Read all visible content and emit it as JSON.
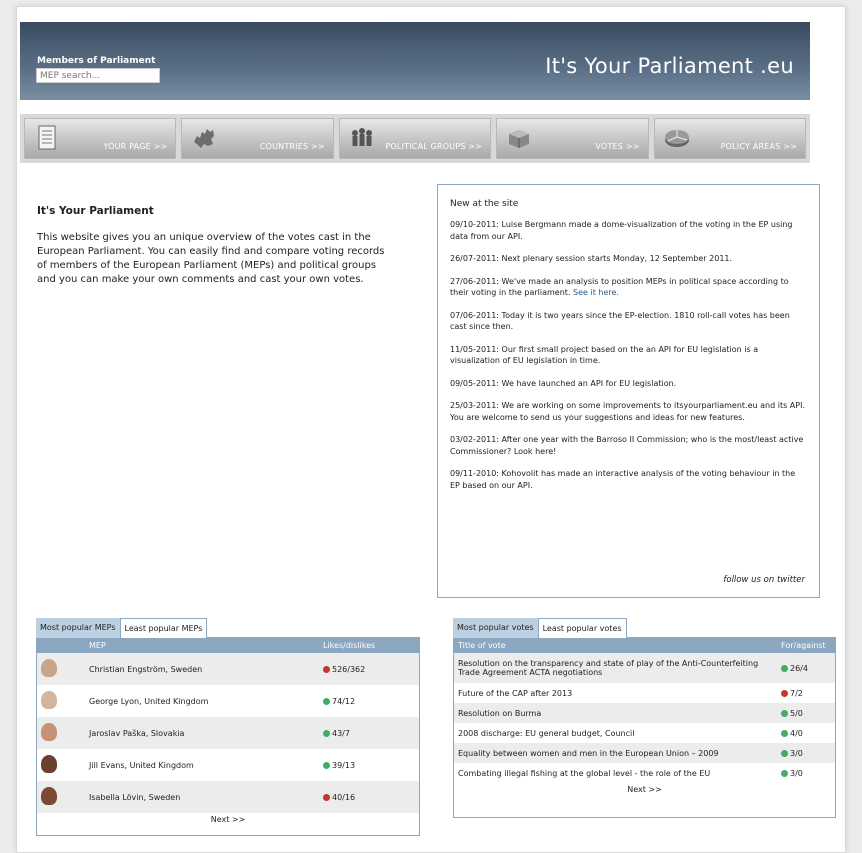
{
  "header": {
    "mep_label": "Members of Parliament",
    "search_placeholder": "MEP search...",
    "site_title": "It's Your Parliament .eu"
  },
  "nav": [
    {
      "label": "YOUR PAGE >>",
      "icon": "document-icon"
    },
    {
      "label": "COUNTRIES >>",
      "icon": "europe-map-icon"
    },
    {
      "label": "POLITICAL GROUPS >>",
      "icon": "people-icon"
    },
    {
      "label": "VOTES >>",
      "icon": "ballot-box-icon"
    },
    {
      "label": "POLICY AREAS >>",
      "icon": "pie-chart-icon"
    }
  ],
  "intro": {
    "title": "It's Your Parliament",
    "text": "This website gives you an unique overview of the votes cast in the European Parliament. You can easily find and compare voting records of members of the European Parliament (MEPs) and political groups and you can make your own comments and cast your own votes."
  },
  "news": {
    "title": "New at the site",
    "items": [
      {
        "text": "09/10-2011: Luise Bergmann made a dome-visualization of the voting in the EP using data from our API.",
        "link": ""
      },
      {
        "text": "26/07-2011: Next plenary session starts Monday, 12 September 2011.",
        "link": ""
      },
      {
        "text": "27/06-2011: We've made an analysis to position MEPs in political space according to their voting in the parliament. ",
        "link": "See it here."
      },
      {
        "text": "07/06-2011: Today it is two years since the EP-election. 1810 roll-call votes has been cast since then.",
        "link": ""
      },
      {
        "text": "11/05-2011: Our first small project based on the an API for EU legislation is a visualization of EU legislation in time.",
        "link": ""
      },
      {
        "text": "09/05-2011: We have launched an API for EU legislation.",
        "link": ""
      },
      {
        "text": "25/03-2011: We are working on some improvements to itsyourparliament.eu and its API. You are welcome to send us your suggestions and ideas for new features.",
        "link": ""
      },
      {
        "text": "03/02-2011: After one year with the Barroso II Commission; who is the most/least active Commissioner? Look here!",
        "link": ""
      },
      {
        "text": "09/11-2010: Kohovolit has made an interactive analysis of the voting behaviour in the EP based on our API.",
        "link": ""
      }
    ],
    "follow": "follow us on twitter"
  },
  "meps": {
    "tab_active": "Most popular MEPs",
    "tab_inactive": "Least popular MEPs",
    "col_mep": "MEP",
    "col_likes": "Likes/dislikes",
    "rows": [
      {
        "name": "Christian Engström, Sweden",
        "value": "526/362",
        "dot": "#c0392b"
      },
      {
        "name": "George Lyon, United Kingdom",
        "value": "74/12",
        "dot": "#3fae63"
      },
      {
        "name": "Jaroslav Paška, Slovakia",
        "value": "43/7",
        "dot": "#3fae63"
      },
      {
        "name": "Jill Evans, United Kingdom",
        "value": "39/13",
        "dot": "#3fae63"
      },
      {
        "name": "Isabella Lövin, Sweden",
        "value": "40/16",
        "dot": "#c0392b"
      }
    ],
    "next": "Next >>"
  },
  "votes": {
    "tab_active": "Most popular votes",
    "tab_inactive": "Least popular votes",
    "col_title": "Title of vote",
    "col_for": "For/against",
    "rows": [
      {
        "title": "Resolution on the transparency and state of play of the Anti-Counterfeiting Trade Agreement ACTA negotiations",
        "value": "26/4",
        "dot": "#3fae63"
      },
      {
        "title": "Future of the CAP after 2013",
        "value": "7/2",
        "dot": "#c0392b"
      },
      {
        "title": "Resolution on Burma",
        "value": "5/0",
        "dot": "#3fae63"
      },
      {
        "title": "2008 discharge: EU general budget, Council",
        "value": "4/0",
        "dot": "#3fae63"
      },
      {
        "title": "Equality between women and men in the European Union – 2009",
        "value": "3/0",
        "dot": "#3fae63"
      },
      {
        "title": "Combating illegal fishing at the global level - the role of the EU",
        "value": "3/0",
        "dot": "#3fae63"
      }
    ],
    "next": "Next >>"
  }
}
